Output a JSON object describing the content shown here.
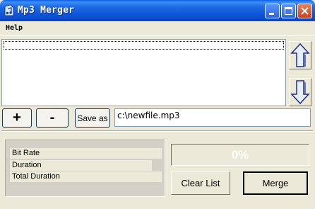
{
  "window": {
    "title": "Mp3 Merger",
    "icon": "music-file-icon",
    "controls": [
      "minimize-icon",
      "maximize-icon",
      "close-icon"
    ]
  },
  "menu": {
    "items": [
      {
        "label": "Help"
      }
    ]
  },
  "file_list": {
    "items": [],
    "move_up_icon": "arrow-up-icon",
    "move_down_icon": "arrow-down-icon"
  },
  "toolbar": {
    "add_label": "+",
    "remove_label": "-",
    "save_as_label": "Save as",
    "output_path": "c:\\newfile.mp3"
  },
  "info": {
    "bit_rate_label": "Bit Rate",
    "duration_label": "Duration",
    "total_duration_label": "Total Duration"
  },
  "progress": {
    "value": 0,
    "text": "0%"
  },
  "actions": {
    "clear_list_label": "Clear List",
    "merge_label": "Merge"
  },
  "colors": {
    "titlebar": "#0A55D6",
    "window_bg": "#ECE9D8",
    "progress_fill": "#316AC5"
  }
}
